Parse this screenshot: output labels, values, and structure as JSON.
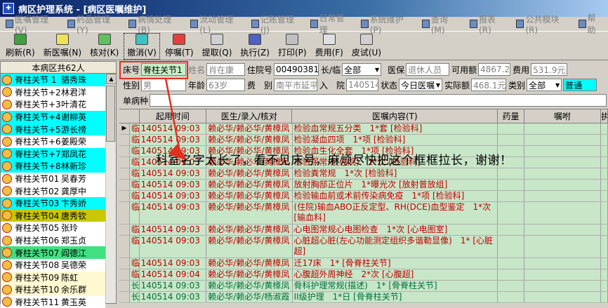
{
  "window": {
    "title": "病区护理系统 - [病区医嘱维护]"
  },
  "menu": [
    "医嘱管理(V)",
    "药品管理(Y)",
    "病情处理(B)",
    "流动管理(L)",
    "记账管理(J)",
    "日常管理",
    "系统维护(P)",
    "查询(M)",
    "报表(R)",
    "公共模块(R)",
    "帮助"
  ],
  "toolbar": [
    {
      "label": "刷新(R)",
      "icon": "refresh-icon"
    },
    {
      "label": "新医嘱(N)",
      "icon": "new-order-icon"
    },
    {
      "label": "核对(K)",
      "icon": "check-icon",
      "dropdown": true
    },
    {
      "label": "撤消(V)",
      "icon": "undo-icon"
    },
    {
      "label": "停嘱(T)",
      "icon": "stop-icon"
    },
    {
      "label": "提取(Q)",
      "icon": "extract-icon",
      "dropdown": true
    },
    {
      "label": "执行(Z)",
      "icon": "execute-icon",
      "dropdown": true
    },
    {
      "label": "打印(P)",
      "icon": "print-icon",
      "dropdown": true
    },
    {
      "label": "费用(F)",
      "icon": "fee-icon"
    },
    {
      "label": "皮试(U)",
      "icon": "skin-test-icon"
    }
  ],
  "sidebar": {
    "header": "本病区共62人",
    "patients": [
      {
        "bed": "脊柱关节 1",
        "name": "骆秀珠",
        "bg": "#00ffff"
      },
      {
        "bed": "脊柱关节+2",
        "name": "林君洋",
        "bg": "#ffffff"
      },
      {
        "bed": "脊柱关节+3",
        "name": "叶清花",
        "bg": "#ffffff"
      },
      {
        "bed": "脊柱关节+4",
        "name": "谢柳英",
        "bg": "#00ffff"
      },
      {
        "bed": "脊柱关节+5",
        "name": "游长榜",
        "bg": "#00ffff"
      },
      {
        "bed": "脊柱关节+6",
        "name": "姜殿荣",
        "bg": "#ffffff"
      },
      {
        "bed": "脊柱关节+7",
        "name": "郑凤花",
        "bg": "#00ffff"
      },
      {
        "bed": "脊柱关节+8",
        "name": "林新珍",
        "bg": "#00ffff"
      },
      {
        "bed": "脊柱关节01",
        "name": "吴春芳",
        "bg": "#ffffff"
      },
      {
        "bed": "脊柱关节02",
        "name": "龚厚中",
        "bg": "#ffffff"
      },
      {
        "bed": "脊柱关节03",
        "name": "卞秀娇",
        "bg": "#00ffff"
      },
      {
        "bed": "脊柱关节04",
        "name": "唐秀钦",
        "bg": "#c8c800"
      },
      {
        "bed": "脊柱关节05",
        "name": "张玲",
        "bg": "#ffffff"
      },
      {
        "bed": "脊柱关节06",
        "name": "郑玉贞",
        "bg": "#ffffff"
      },
      {
        "bed": "脊柱关节07",
        "name": "阎德江",
        "bg": "#40e080"
      },
      {
        "bed": "脊柱关节08",
        "name": "吴德荣",
        "bg": "#ffffff"
      },
      {
        "bed": "脊柱关节09",
        "name": "陈虹",
        "bg": "#fff8d0"
      },
      {
        "bed": "脊柱关节10",
        "name": "余乐群",
        "bg": "#fff8d0"
      },
      {
        "bed": "脊柱关节11",
        "name": "黄玉英",
        "bg": "#ffffff"
      }
    ]
  },
  "form": {
    "bed_label": "床号",
    "bed_value": "脊柱关节1",
    "name_label": "姓名",
    "name_value": "肖在康",
    "inpatient_label": "住院号",
    "inpatient_value": "00490381",
    "longterm_label": "长/临",
    "longterm_value": "全部",
    "insurance_label": "医保",
    "insurance_value": "退休人员",
    "available_label": "可用额",
    "available_value": "4867.23",
    "fee_label": "费用",
    "fee_value": "531.9元",
    "gender_label": "性别",
    "gender_value": "男",
    "age_label": "年龄",
    "age_value": "63岁",
    "fee_type_label": "费　别",
    "fee_type_value": "南平市延平",
    "admit_label": "入　院",
    "admit_value": "140514",
    "status_label": "状态",
    "status_value": "今日医嘱",
    "actual_label": "实际额",
    "actual_value": "468.1元",
    "category_label": "类别",
    "category_value": "全部",
    "level_value": "普通",
    "disease_label": "单病种"
  },
  "grid": {
    "headers": [
      "",
      "起用时间",
      "医生/录入/核对",
      "医嘱内容(T)",
      "药量",
      "嘱咐",
      "执"
    ],
    "rows": [
      {
        "type": "临",
        "time": "140514 09:03",
        "doc": "赖必华/赖必华/黄樟凤",
        "content": "检验血常规五分类　1*套 [检验科]",
        "color": "#c00000",
        "current": true
      },
      {
        "type": "临",
        "time": "140514 09:03",
        "doc": "赖必华/赖必华/黄樟凤",
        "content": "检验凝血四项　1*项 [检验科]",
        "color": "#c00000"
      },
      {
        "type": "临",
        "time": "140514 09:03",
        "doc": "赖必华/赖必华/黄樟凤",
        "content": "检验血生化全套　1*项 [检验科]",
        "color": "#c00000"
      },
      {
        "type": "临",
        "time": "140514 09:03",
        "doc": "赖必华/赖必华/黄樟凤",
        "content": "检验尿常规(住院)　1*次 [检验科]",
        "color": "#c00000"
      },
      {
        "type": "临",
        "time": "140514 09:03",
        "doc": "赖必华/赖必华/黄樟凤",
        "content": "检验粪常规　1*次 [检验科]",
        "color": "#c00000"
      },
      {
        "type": "临",
        "time": "140514 09:03",
        "doc": "赖必华/赖必华/黄樟凤",
        "content": "放射胸部正位片　1*曝光次 [放射普放组]",
        "color": "#c00000"
      },
      {
        "type": "临",
        "time": "140514 09:03",
        "doc": "赖必华/赖必华/黄樟凤",
        "content": "检验输血前或术前传染病免疫　1*项 [检验科]",
        "color": "#c00000"
      },
      {
        "type": "临",
        "time": "140514 09:03",
        "doc": "赖必华/赖必华/黄樟凤",
        "content": "(住院)输血ABO正反定型、RH(DCE)血型鉴定　1*次 [输血科]",
        "color": "#c00000",
        "tall": true
      },
      {
        "type": "临",
        "time": "140514 09:03",
        "doc": "赖必华/赖必华/黄樟凤",
        "content": "心电图常规心电图检查　1*次 [心电图室]",
        "color": "#c00000"
      },
      {
        "type": "临",
        "time": "140514 09:03",
        "doc": "赖必华/赖必华/黄樟凤",
        "content": "心脏超心脏(左心功能测定组织多谐勒显像)　1* [心脏超]",
        "color": "#c00000",
        "tall": true
      },
      {
        "type": "临",
        "time": "140514 09:03",
        "doc": "赖必华/赖必华/黄樟凤",
        "content": "迁17床　1* [骨脊柱关节]",
        "color": "#c00000"
      },
      {
        "type": "临",
        "time": "140514 09:04",
        "doc": "赖必华/赖必华/黄樟凤",
        "content": "心腹超外周神经　2*次 [心腹超]",
        "color": "#c00000"
      },
      {
        "type": "长",
        "time": "140514 09:03",
        "doc": "赖必华/赖必华/黄樟凤",
        "content": "骨科护理常规(描述)　1* [骨脊柱关节]",
        "color": "#007040"
      },
      {
        "type": "长",
        "time": "140514 09:03",
        "doc": "赖必华/赖必华/杨淑霞",
        "content": "II级护理　1*日 [骨脊柱关节]",
        "color": "#007040"
      }
    ]
  },
  "annotation": {
    "text": "科室名字太长了，看不见床号，麻烦尽快把这个框框拉长，谢谢！"
  }
}
